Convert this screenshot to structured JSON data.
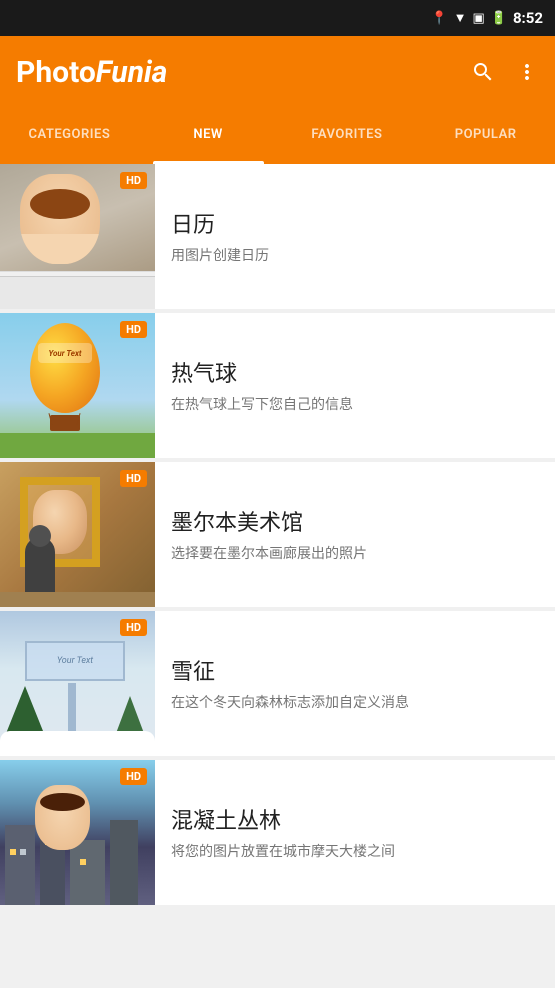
{
  "statusBar": {
    "time": "8:52",
    "icons": [
      "location",
      "wifi",
      "signal",
      "battery"
    ]
  },
  "appBar": {
    "logoPhoto": "Photo",
    "logoFunia": "Funia",
    "searchLabel": "search",
    "moreLabel": "more options"
  },
  "tabs": [
    {
      "id": "categories",
      "label": "CATEGORIES",
      "active": false
    },
    {
      "id": "new",
      "label": "NEW",
      "active": true
    },
    {
      "id": "favorites",
      "label": "FAVORITES",
      "active": false
    },
    {
      "id": "popular",
      "label": "POPULAR",
      "active": false
    }
  ],
  "items": [
    {
      "id": "calendar",
      "title": "日历",
      "description": "用图片创建日历",
      "hd": true,
      "thumbType": "calendar"
    },
    {
      "id": "balloon",
      "title": "热气球",
      "description": "在热气球上写下您自己的信息",
      "hd": true,
      "thumbType": "balloon"
    },
    {
      "id": "museum",
      "title": "墨尔本美术馆",
      "description": "选择要在墨尔本画廊展出的照片",
      "hd": true,
      "thumbType": "museum"
    },
    {
      "id": "snow",
      "title": "雪征",
      "description": "在这个冬天向森林标志添加自定义消息",
      "hd": true,
      "thumbType": "snow"
    },
    {
      "id": "city",
      "title": "混凝土丛林",
      "description": "将您的图片放置在城市摩天大楼之间",
      "hd": true,
      "thumbType": "city"
    }
  ]
}
